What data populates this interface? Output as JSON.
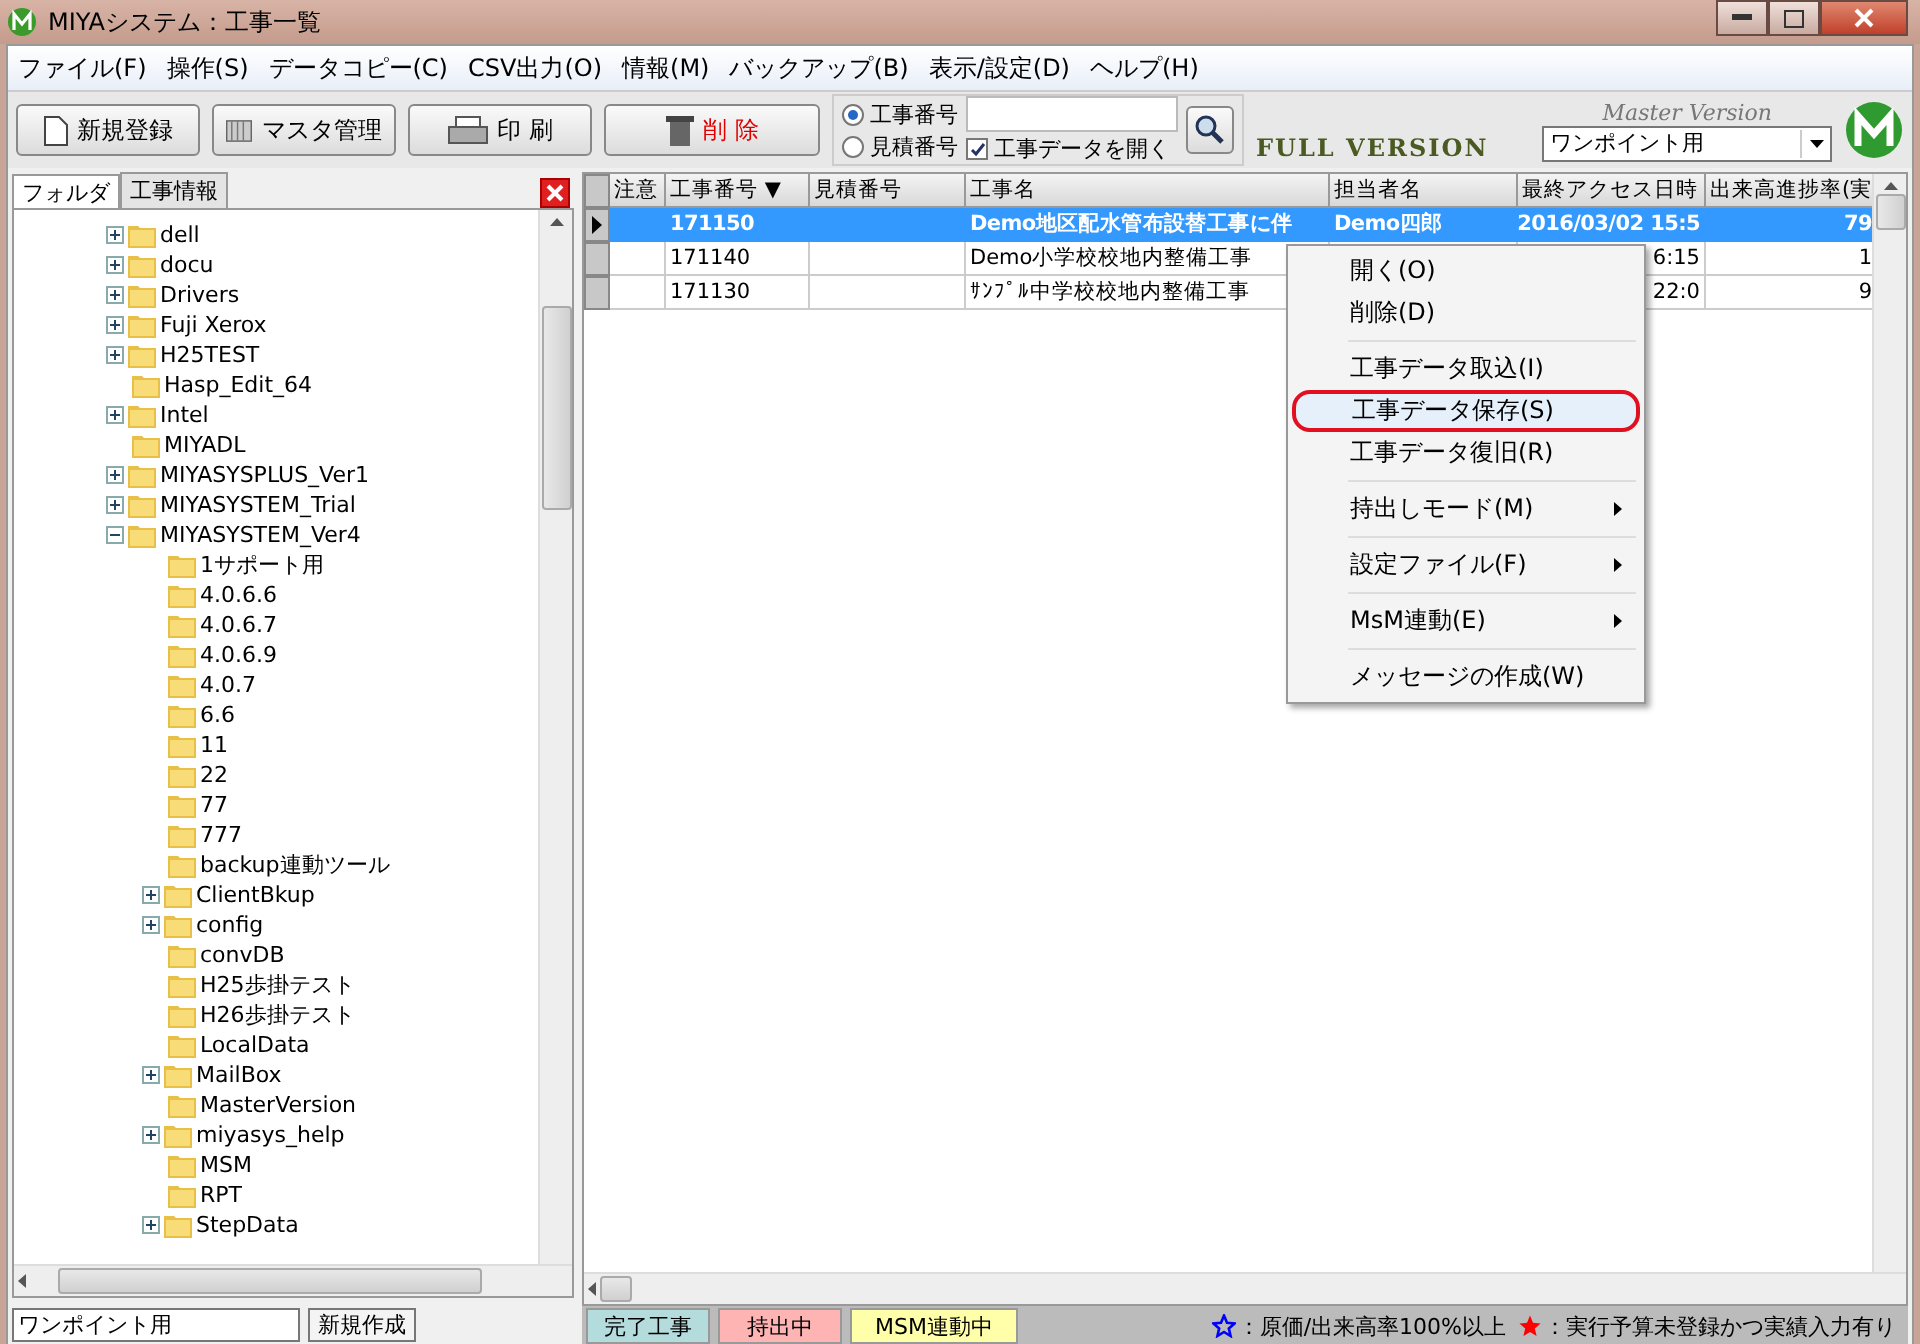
{
  "window": {
    "title": "MIYAシステム：工事一覧"
  },
  "menu": [
    "ファイル(F)",
    "操作(S)",
    "データコピー(C)",
    "CSV出力(O)",
    "情報(M)",
    "バックアップ(B)",
    "表示/設定(D)",
    "ヘルプ(H)"
  ],
  "toolbar": {
    "buttons": [
      {
        "kind": "new",
        "label": "新規登録"
      },
      {
        "kind": "master",
        "label": "マスタ管理"
      },
      {
        "kind": "print",
        "label": "印 刷"
      },
      {
        "kind": "delete",
        "label": "削 除"
      }
    ],
    "radios": [
      {
        "label": "工事番号",
        "selected": true
      },
      {
        "label": "見積番号",
        "selected": false
      }
    ],
    "open_data": {
      "label": "工事データを開く",
      "checked": true
    },
    "full_version": "FULL VERSION",
    "master_version": "Master Version",
    "dropdown": "ワンポイント用"
  },
  "left_tabs": [
    {
      "label": "フォルダ",
      "selected": true
    },
    {
      "label": "工事情報",
      "selected": false
    }
  ],
  "tree": [
    {
      "label": "dell",
      "expanded": false
    },
    {
      "label": "docu",
      "expanded": false
    },
    {
      "label": "Drivers",
      "expanded": false
    },
    {
      "label": "Fuji Xerox",
      "expanded": false
    },
    {
      "label": "H25TEST",
      "expanded": false
    },
    {
      "label": "Hasp_Edit_64"
    },
    {
      "label": "Intel",
      "expanded": false
    },
    {
      "label": "MIYADL"
    },
    {
      "label": "MIYASYSPLUS_Ver1",
      "expanded": false
    },
    {
      "label": "MIYASYSTEM_Trial",
      "expanded": false
    },
    {
      "label": "MIYASYSTEM_Ver4",
      "expanded": true,
      "children": [
        {
          "label": "1サポート用"
        },
        {
          "label": "4.0.6.6"
        },
        {
          "label": "4.0.6.7"
        },
        {
          "label": "4.0.6.9"
        },
        {
          "label": "4.0.7"
        },
        {
          "label": "6.6"
        },
        {
          "label": "11"
        },
        {
          "label": "22"
        },
        {
          "label": "77"
        },
        {
          "label": "777"
        },
        {
          "label": "backup連動ツール"
        },
        {
          "label": "ClientBkup",
          "expanded": false
        },
        {
          "label": "config",
          "expanded": false
        },
        {
          "label": "convDB"
        },
        {
          "label": "H25歩掛テスト"
        },
        {
          "label": "H26歩掛テスト"
        },
        {
          "label": "LocalData"
        },
        {
          "label": "MailBox",
          "expanded": false
        },
        {
          "label": "MasterVersion"
        },
        {
          "label": "miyasys_help",
          "expanded": false
        },
        {
          "label": "MSM"
        },
        {
          "label": "RPT"
        },
        {
          "label": "StepData",
          "expanded": false
        }
      ]
    }
  ],
  "left_footer": {
    "field_value": "ワンポイント用",
    "button": "新規作成"
  },
  "table": {
    "columns": [
      "注意",
      "工事番号 ▼",
      "見積番号",
      "工事名",
      "担当者名",
      "最終アクセス日時",
      "出来高進捗率(実"
    ],
    "rows": [
      {
        "selected": true,
        "cells": [
          "",
          "171150",
          "",
          "Demo地区配水管布設替工事に伴",
          "Demo四郎",
          "2016/03/02 15:5",
          "79"
        ]
      },
      {
        "selected": false,
        "cells": [
          "",
          "171140",
          "",
          "Demo小学校校地内整備工事",
          "",
          "6:15",
          "1"
        ]
      },
      {
        "selected": false,
        "cells": [
          "",
          "171130",
          "",
          "ｻﾝﾌﾟﾙ中学校校地内整備工事",
          "",
          "22:0",
          "9"
        ]
      }
    ]
  },
  "context_menu": [
    [
      {
        "label": "開く(O)",
        "submenu": false,
        "selected": false
      },
      {
        "label": "削除(D)",
        "submenu": false,
        "selected": false
      }
    ],
    [
      {
        "label": "工事データ取込(I)",
        "submenu": false,
        "selected": false
      },
      {
        "label": "工事データ保存(S)",
        "submenu": false,
        "selected": true
      },
      {
        "label": "工事データ復旧(R)",
        "submenu": false,
        "selected": false
      }
    ],
    [
      {
        "label": "持出しモード(M)",
        "submenu": true,
        "selected": false
      }
    ],
    [
      {
        "label": "設定ファイル(F)",
        "submenu": true,
        "selected": false
      }
    ],
    [
      {
        "label": "MsM連動(E)",
        "submenu": true,
        "selected": false
      }
    ],
    [
      {
        "label": "メッセージの作成(W)",
        "submenu": false,
        "selected": false
      }
    ]
  ],
  "legend": [
    {
      "label": "完了工事",
      "color": "#b4dcdc"
    },
    {
      "label": "持出中",
      "color": "#ffb4b4"
    },
    {
      "label": "MSM連動中",
      "color": "#ffffaa"
    }
  ],
  "notes": [
    {
      "kind": "outline",
      "color": "#0000ff",
      "text": "：原価/出来高率100%以上"
    },
    {
      "kind": "filled",
      "color": "#ff0000",
      "text": "：実行予算未登録かつ実績入力有り"
    }
  ]
}
